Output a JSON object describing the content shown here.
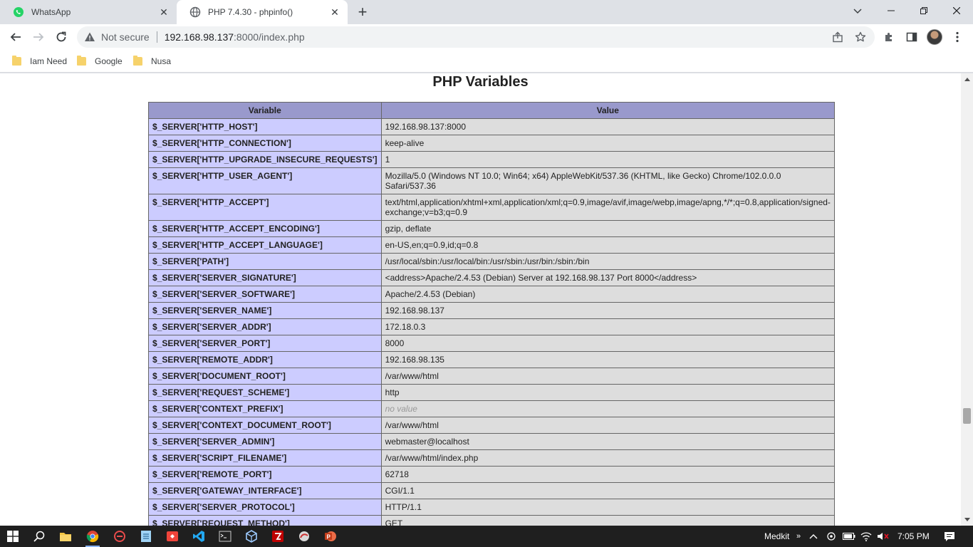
{
  "browser": {
    "tabs": [
      {
        "title": "WhatsApp",
        "icon": "whatsapp-icon"
      },
      {
        "title": "PHP 7.4.30 - phpinfo()",
        "icon": "globe-icon"
      }
    ],
    "address": {
      "security_label": "Not secure",
      "host": "192.168.98.137",
      "path": ":8000/index.php"
    },
    "bookmarks": [
      "Iam Need",
      "Google",
      "Nusa"
    ]
  },
  "page": {
    "title": "PHP Variables",
    "table": {
      "headers": [
        "Variable",
        "Value"
      ],
      "rows": [
        {
          "variable": "$_SERVER['HTTP_HOST']",
          "value": "192.168.98.137:8000"
        },
        {
          "variable": "$_SERVER['HTTP_CONNECTION']",
          "value": "keep-alive"
        },
        {
          "variable": "$_SERVER['HTTP_UPGRADE_INSECURE_REQUESTS']",
          "value": "1"
        },
        {
          "variable": "$_SERVER['HTTP_USER_AGENT']",
          "value": "Mozilla/5.0 (Windows NT 10.0; Win64; x64) AppleWebKit/537.36 (KHTML, like Gecko) Chrome/102.0.0.0 Safari/537.36"
        },
        {
          "variable": "$_SERVER['HTTP_ACCEPT']",
          "value": "text/html,application/xhtml+xml,application/xml;q=0.9,image/avif,image/webp,image/apng,*/*;q=0.8,application/signed-exchange;v=b3;q=0.9"
        },
        {
          "variable": "$_SERVER['HTTP_ACCEPT_ENCODING']",
          "value": "gzip, deflate"
        },
        {
          "variable": "$_SERVER['HTTP_ACCEPT_LANGUAGE']",
          "value": "en-US,en;q=0.9,id;q=0.8"
        },
        {
          "variable": "$_SERVER['PATH']",
          "value": "/usr/local/sbin:/usr/local/bin:/usr/sbin:/usr/bin:/sbin:/bin"
        },
        {
          "variable": "$_SERVER['SERVER_SIGNATURE']",
          "value": "<address>Apache/2.4.53 (Debian) Server at 192.168.98.137 Port 8000</address>"
        },
        {
          "variable": "$_SERVER['SERVER_SOFTWARE']",
          "value": "Apache/2.4.53 (Debian)"
        },
        {
          "variable": "$_SERVER['SERVER_NAME']",
          "value": "192.168.98.137"
        },
        {
          "variable": "$_SERVER['SERVER_ADDR']",
          "value": "172.18.0.3"
        },
        {
          "variable": "$_SERVER['SERVER_PORT']",
          "value": "8000"
        },
        {
          "variable": "$_SERVER['REMOTE_ADDR']",
          "value": "192.168.98.135"
        },
        {
          "variable": "$_SERVER['DOCUMENT_ROOT']",
          "value": "/var/www/html"
        },
        {
          "variable": "$_SERVER['REQUEST_SCHEME']",
          "value": "http"
        },
        {
          "variable": "$_SERVER['CONTEXT_PREFIX']",
          "value": "no value",
          "no_value": true
        },
        {
          "variable": "$_SERVER['CONTEXT_DOCUMENT_ROOT']",
          "value": "/var/www/html"
        },
        {
          "variable": "$_SERVER['SERVER_ADMIN']",
          "value": "webmaster@localhost"
        },
        {
          "variable": "$_SERVER['SCRIPT_FILENAME']",
          "value": "/var/www/html/index.php"
        },
        {
          "variable": "$_SERVER['REMOTE_PORT']",
          "value": "62718"
        },
        {
          "variable": "$_SERVER['GATEWAY_INTERFACE']",
          "value": "CGI/1.1"
        },
        {
          "variable": "$_SERVER['SERVER_PROTOCOL']",
          "value": "HTTP/1.1"
        },
        {
          "variable": "$_SERVER['REQUEST_METHOD']",
          "value": "GET"
        }
      ]
    }
  },
  "taskbar": {
    "tray_label": "Medkit",
    "clock": "7:05 PM"
  },
  "colors": {
    "table_header": "#9999cc",
    "variable_cell": "#ccccff",
    "value_cell": "#dddddd"
  }
}
